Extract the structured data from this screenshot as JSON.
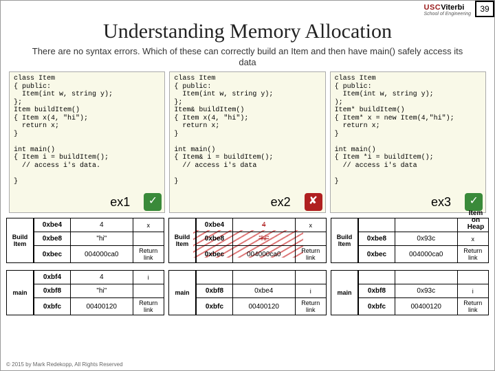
{
  "page": {
    "number": "39"
  },
  "branding": {
    "prefix": "USC",
    "name": "Viterbi",
    "subline": "School of Engineering"
  },
  "title": "Understanding Memory Allocation",
  "subtitle": "There are no syntax errors.  Which of these can correctly build an Item and then have main() safely access its data",
  "code": {
    "ex1": {
      "label": "ex1",
      "text": "class Item\n{ public:\n  Item(int w, string y);\n};\nItem buildItem()\n{ Item x(4, \"hi\");\n  return x;\n}\n\nint main()\n{ Item i = buildItem();\n  // access i's data.\n\n}"
    },
    "ex2": {
      "label": "ex2",
      "text": "class Item\n{ public:\n  Item(int w, string y);\n};\nItem& buildItem()\n{ Item x(4, \"hi\");\n  return x;\n}\n\nint main()\n{ Item& i = buildItem();\n  // access i's data\n\n}"
    },
    "ex3": {
      "label": "ex3",
      "text": "class Item\n{ public:\n  Item(int w, string y);\n);\nItem* buildItem()\n{ Item* x = new Item(4,\"hi\");\n  return x;\n}\n\nint main()\n{ Item *i = buildItem();\n  // access i's data\n\n}"
    }
  },
  "itemheap": "Item\non\nHeap",
  "memory": {
    "ex1": {
      "build": {
        "label": "Build\nItem",
        "rows": [
          {
            "addr": "0xbe4",
            "val": "4",
            "lbl": "x"
          },
          {
            "addr": "0xbe8",
            "val": "\"hi\"",
            "lbl": ""
          },
          {
            "addr": "0xbec",
            "val": "004000ca0",
            "lbl": "Return\nlink"
          }
        ]
      },
      "main": {
        "label": "main",
        "rows": [
          {
            "addr": "0xbf4",
            "val": "4",
            "lbl": "i"
          },
          {
            "addr": "0xbf8",
            "val": "\"hi\"",
            "lbl": ""
          },
          {
            "addr": "0xbfc",
            "val": "00400120",
            "lbl": "Return\nlink"
          }
        ]
      }
    },
    "ex2": {
      "build": {
        "label": "Build\nItem",
        "rows": [
          {
            "addr": "0xbe4",
            "val": "4",
            "lbl": "x"
          },
          {
            "addr": "0xbe8",
            "val": "\"hi\"",
            "lbl": ""
          },
          {
            "addr": "0xbec",
            "val": "004000ca0",
            "lbl": "Return\nlink"
          }
        ]
      },
      "main": {
        "label": "main",
        "rows": [
          {
            "addr": "0xbf8",
            "val": "0xbe4",
            "lbl": "i"
          },
          {
            "addr": "0xbfc",
            "val": "00400120",
            "lbl": "Return\nlink"
          }
        ]
      }
    },
    "ex3": {
      "build": {
        "label": "Build\nItem",
        "rows": [
          {
            "addr": "0xbe8",
            "val": "0x93c",
            "lbl": "x"
          },
          {
            "addr": "0xbec",
            "val": "004000ca0",
            "lbl": "Return\nlink"
          }
        ]
      },
      "main": {
        "label": "main",
        "rows": [
          {
            "addr": "0xbf8",
            "val": "0x93c",
            "lbl": "i"
          },
          {
            "addr": "0xbfc",
            "val": "00400120",
            "lbl": "Return\nlink"
          }
        ]
      }
    }
  },
  "footer": "© 2015 by Mark Redekopp, All Rights Reserved"
}
